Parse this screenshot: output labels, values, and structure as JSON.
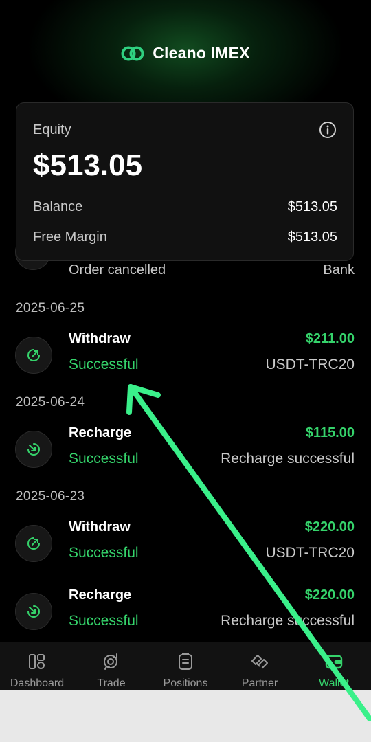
{
  "app": {
    "brand": "Cleano IMEX"
  },
  "equity_card": {
    "label": "Equity",
    "value": "$513.05",
    "rows": [
      {
        "label": "Balance",
        "value": "$513.05"
      },
      {
        "label": "Free Margin",
        "value": "$513.05"
      }
    ]
  },
  "partial_item": {
    "text": "Order cancelled",
    "note": "Bank"
  },
  "groups": [
    {
      "date": "2025-06-25",
      "items": [
        {
          "type": "Withdraw",
          "status": "Successful",
          "amount": "$211.00",
          "note": "USDT-TRC20",
          "icon": "withdraw-icon"
        }
      ]
    },
    {
      "date": "2025-06-24",
      "items": [
        {
          "type": "Recharge",
          "status": "Successful",
          "amount": "$115.00",
          "note": "Recharge successful",
          "icon": "recharge-icon"
        }
      ]
    },
    {
      "date": "2025-06-23",
      "items": [
        {
          "type": "Withdraw",
          "status": "Successful",
          "amount": "$220.00",
          "note": "USDT-TRC20",
          "icon": "withdraw-icon"
        },
        {
          "type": "Recharge",
          "status": "Successful",
          "amount": "$220.00",
          "note": "Recharge successful",
          "icon": "recharge-icon"
        }
      ]
    }
  ],
  "nav": [
    {
      "label": "Dashboard",
      "icon": "dashboard-icon"
    },
    {
      "label": "Trade",
      "icon": "trade-icon"
    },
    {
      "label": "Positions",
      "icon": "positions-icon"
    },
    {
      "label": "Partner",
      "icon": "partner-icon"
    },
    {
      "label": "Wallet",
      "icon": "wallet-icon",
      "active": true
    }
  ],
  "colors": {
    "accent": "#35d36b",
    "background": "#000000",
    "card": "#111111",
    "annotation_arrow": "#3af08a"
  }
}
